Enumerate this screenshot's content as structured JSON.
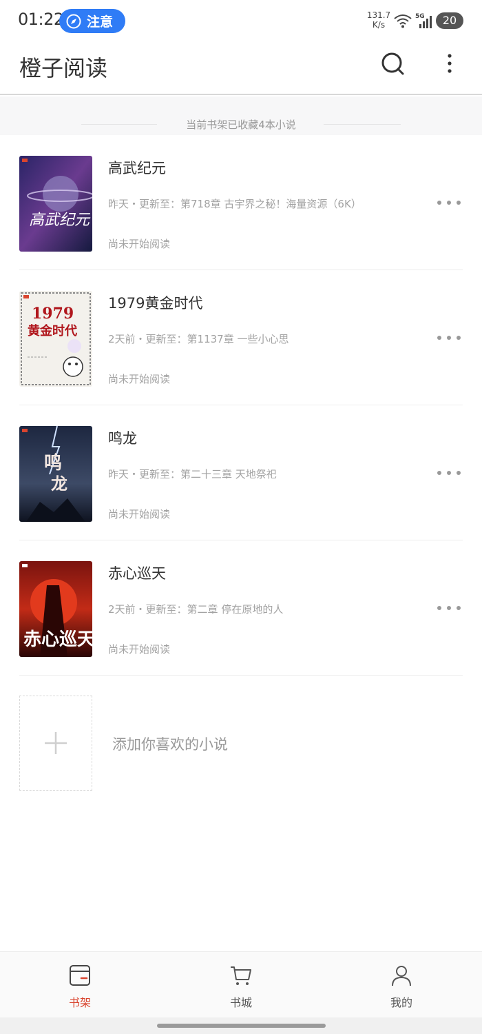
{
  "status_bar": {
    "time": "01:22",
    "notice_label": "注意",
    "net_speed_value": "131.7",
    "net_speed_unit": "K/s",
    "battery": "20",
    "wifi_icon": "wifi-icon",
    "signal_icon": "signal-5g-icon"
  },
  "header": {
    "title": "橙子阅读",
    "search_icon": "search-icon",
    "more_icon": "more-vertical-icon"
  },
  "shelf": {
    "summary": "当前书架已收藏4本小说",
    "books": [
      {
        "title": "高武纪元",
        "update": "昨天・更新至：第718章  古宇界之秘！海量资源（6K）",
        "status": "尚未开始阅读",
        "cover_colors": [
          "#1b1f5c",
          "#6a3b8f"
        ]
      },
      {
        "title": "1979黄金时代",
        "update": "2天前・更新至：第1137章  一些小心思",
        "status": "尚未开始阅读",
        "cover_colors": [
          "#f3f1ec",
          "#b0161c"
        ]
      },
      {
        "title": "鸣龙",
        "update": "昨天・更新至：第二十三章  天地祭祀",
        "status": "尚未开始阅读",
        "cover_colors": [
          "#121a2a",
          "#3d4a66"
        ]
      },
      {
        "title": "赤心巡天",
        "update": "2天前・更新至：第二章  停在原地的人",
        "status": "尚未开始阅读",
        "cover_colors": [
          "#5c0c0a",
          "#d8321b"
        ]
      }
    ],
    "add_label": "添加你喜欢的小说"
  },
  "bottom_nav": {
    "items": [
      {
        "label": "书架",
        "icon": "bookshelf-icon",
        "active": true
      },
      {
        "label": "书城",
        "icon": "cart-icon",
        "active": false
      },
      {
        "label": "我的",
        "icon": "user-icon",
        "active": false
      }
    ]
  },
  "colors": {
    "accent": "#d9442e",
    "notice_blue": "#2f7cf6",
    "muted_text": "#a2a2a2"
  }
}
